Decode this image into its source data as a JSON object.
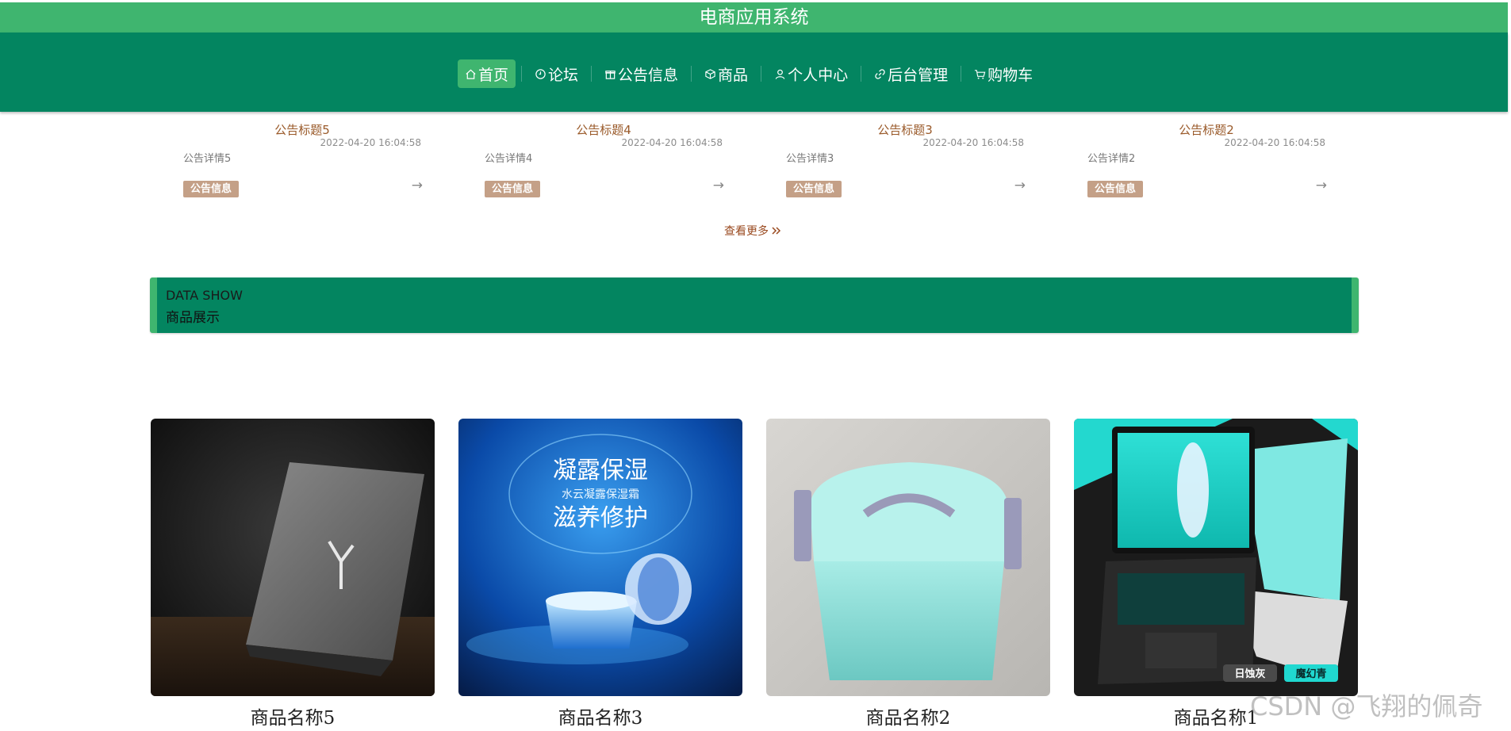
{
  "app": {
    "title": "电商应用系统"
  },
  "nav": {
    "items": [
      {
        "label": "首页",
        "icon": "home-icon",
        "active": true
      },
      {
        "label": "论坛",
        "icon": "clock-icon"
      },
      {
        "label": "公告信息",
        "icon": "gift-icon"
      },
      {
        "label": "商品",
        "icon": "cube-icon"
      },
      {
        "label": "个人中心",
        "icon": "user-icon"
      },
      {
        "label": "后台管理",
        "icon": "link-icon"
      },
      {
        "label": "购物车",
        "icon": "cart-icon"
      }
    ]
  },
  "notices": [
    {
      "title": "公告标题5",
      "date": "2022-04-20 16:04:58",
      "desc": "公告详情5",
      "tag": "公告信息",
      "arrow": "→"
    },
    {
      "title": "公告标题4",
      "date": "2022-04-20 16:04:58",
      "desc": "公告详情4",
      "tag": "公告信息",
      "arrow": "→"
    },
    {
      "title": "公告标题3",
      "date": "2022-04-20 16:04:58",
      "desc": "公告详情3",
      "tag": "公告信息",
      "arrow": "→"
    },
    {
      "title": "公告标题2",
      "date": "2022-04-20 16:04:58",
      "desc": "公告详情2",
      "tag": "公告信息",
      "arrow": "→"
    }
  ],
  "more": {
    "label": "查看更多"
  },
  "data_show": {
    "en": "DATA SHOW",
    "cn": "商品展示"
  },
  "products": [
    {
      "name": "商品名称5"
    },
    {
      "name": "商品名称3"
    },
    {
      "name": "商品名称2"
    },
    {
      "name": "商品名称1"
    }
  ],
  "product_image_text": {
    "cream_heading": "凝露保湿",
    "cream_sub": "水云凝露保湿霜",
    "cream_slogan": "滋养修护",
    "laptop_badge_left": "日蚀灰",
    "laptop_badge_right": "魔幻青"
  },
  "watermark": "CSDN @飞翔的佩奇",
  "colors": {
    "header": "#3fb56f",
    "nav": "#038560",
    "title_brown": "#9a5a2a",
    "tag_bg": "#c4a087"
  }
}
